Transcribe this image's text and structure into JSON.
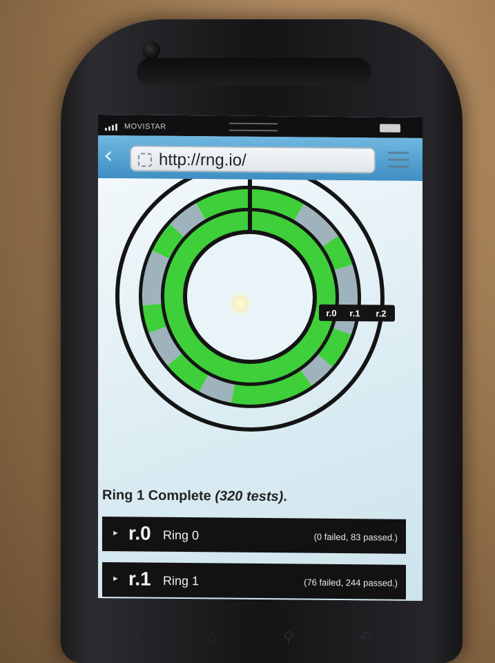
{
  "status_bar": {
    "carrier": "MOVISTAR"
  },
  "browser": {
    "url": "http://rng.io/"
  },
  "rings": {
    "labels": [
      "r.0",
      "r.1",
      "r.2"
    ],
    "colors": {
      "pass": "#3fcf3a",
      "fail": "#9fb3bc",
      "ring_border": "#141414"
    }
  },
  "summary": {
    "prefix": "Ring 1 Complete",
    "detail": "(320 tests)",
    "suffix": "."
  },
  "ring_list": [
    {
      "code": "r.0",
      "name": "Ring 0",
      "stats": "(0 failed, 83 passed.)"
    },
    {
      "code": "r.1",
      "name": "Ring 1",
      "stats": "(76 failed, 244 passed.)"
    }
  ]
}
